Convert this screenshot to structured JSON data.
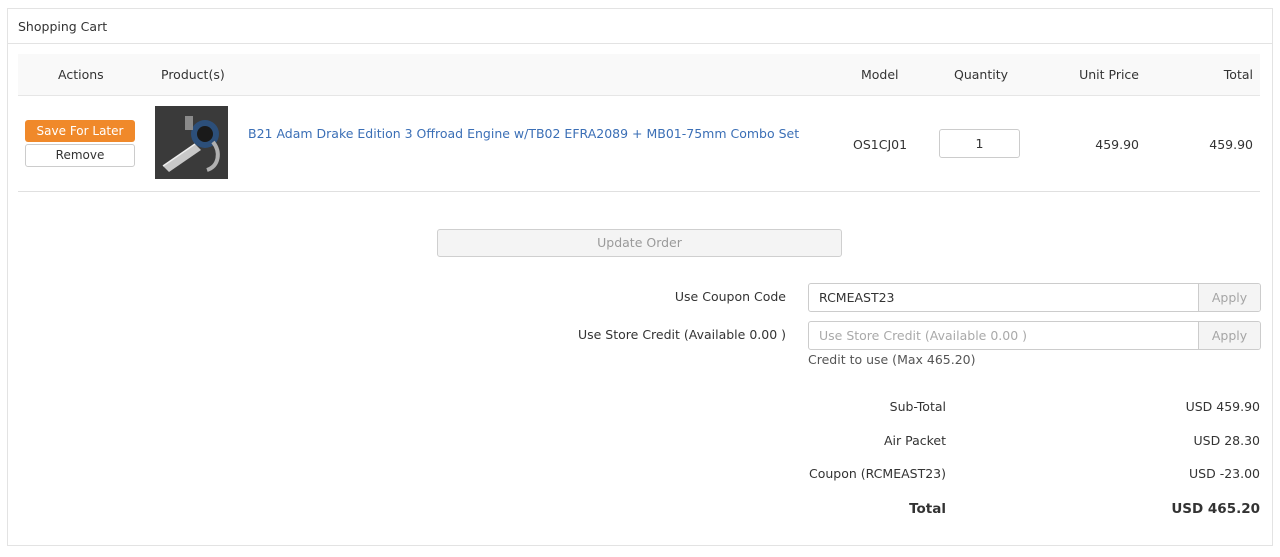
{
  "panel": {
    "title": "Shopping Cart"
  },
  "table": {
    "headers": {
      "actions": "Actions",
      "products": "Product(s)",
      "model": "Model",
      "quantity": "Quantity",
      "unit_price": "Unit Price",
      "total": "Total"
    },
    "rows": [
      {
        "save_label": "Save For Later",
        "remove_label": "Remove",
        "product_name": "B21 Adam Drake Edition 3 Offroad Engine w/TB02 EFRA2089 + MB01-75mm Combo Set",
        "model": "OS1CJ01",
        "quantity": "1",
        "unit_price": "459.90",
        "total": "459.90"
      }
    ]
  },
  "update_button": "Update Order",
  "coupon": {
    "label": "Use Coupon Code",
    "value": "RCMEAST23",
    "apply_label": "Apply"
  },
  "store_credit": {
    "label": "Use Store Credit (Available 0.00 )",
    "placeholder": "Use Store Credit (Available 0.00 )",
    "apply_label": "Apply",
    "note": "Credit to use (Max 465.20)"
  },
  "summary": [
    {
      "label": "Sub-Total",
      "value": "USD 459.90"
    },
    {
      "label": "Air Packet",
      "value": "USD 28.30"
    },
    {
      "label": "Coupon (RCMEAST23)",
      "value": "USD -23.00"
    },
    {
      "label": "Total",
      "value": "USD 465.20"
    }
  ],
  "colors": {
    "accent": "#f0892a",
    "link": "#3b6fb6",
    "border": "#e3e3e3",
    "header_bg": "#f9f9f9"
  }
}
